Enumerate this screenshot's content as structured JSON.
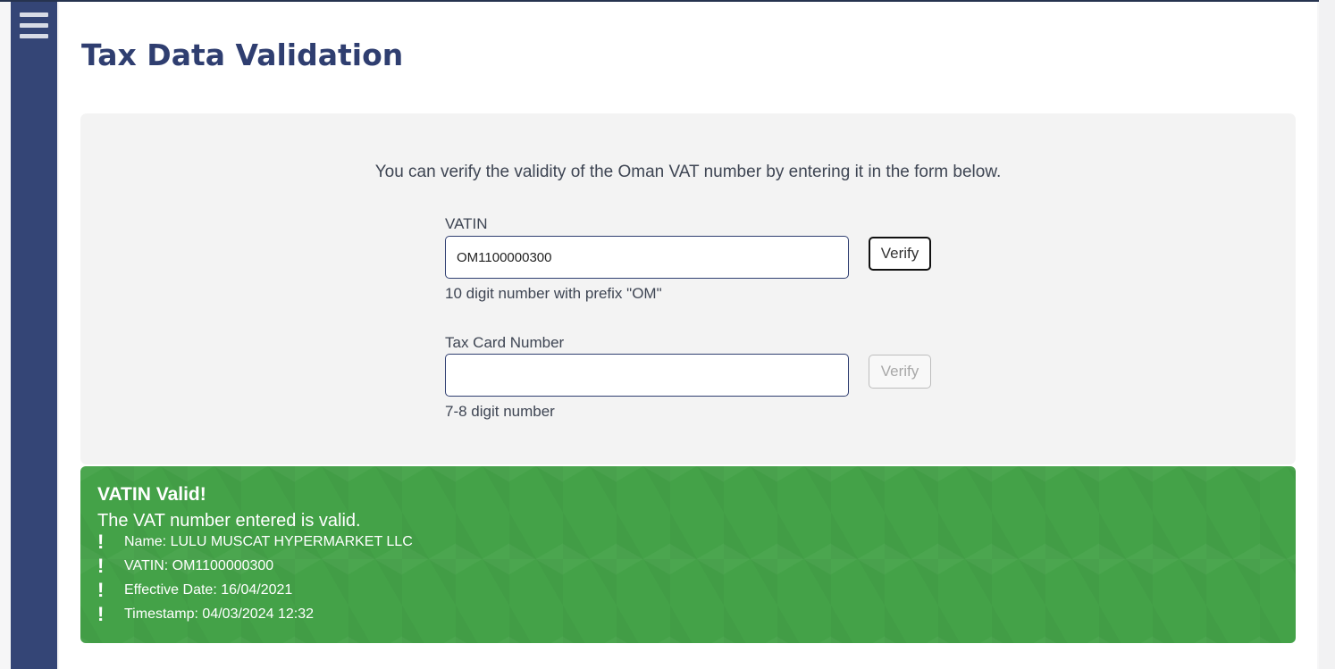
{
  "page": {
    "title": "Tax Data Validation"
  },
  "form": {
    "intro": "You can verify the validity of the Oman VAT number by entering it in the form below.",
    "vatin": {
      "label": "VATIN",
      "value": "OM1100000300",
      "hint": "10 digit number with prefix \"OM\"",
      "button": "Verify"
    },
    "tax_card": {
      "label": "Tax Card Number",
      "value": "",
      "hint": "7-8 digit number",
      "button": "Verify"
    }
  },
  "result": {
    "title": "VATIN Valid!",
    "subtitle": "The VAT number entered is valid.",
    "items": [
      "Name: LULU MUSCAT HYPERMARKET LLC",
      "VATIN: OM1100000300",
      "Effective Date: 16/04/2021",
      "Timestamp: 04/03/2024 12:32"
    ]
  },
  "colors": {
    "sidebar": "#344576",
    "title": "#2f3e70",
    "success": "#44a248",
    "panel": "#f3f3f3"
  },
  "icons": {
    "menu": "hamburger-menu-icon",
    "bullet": "exclamation-icon"
  }
}
